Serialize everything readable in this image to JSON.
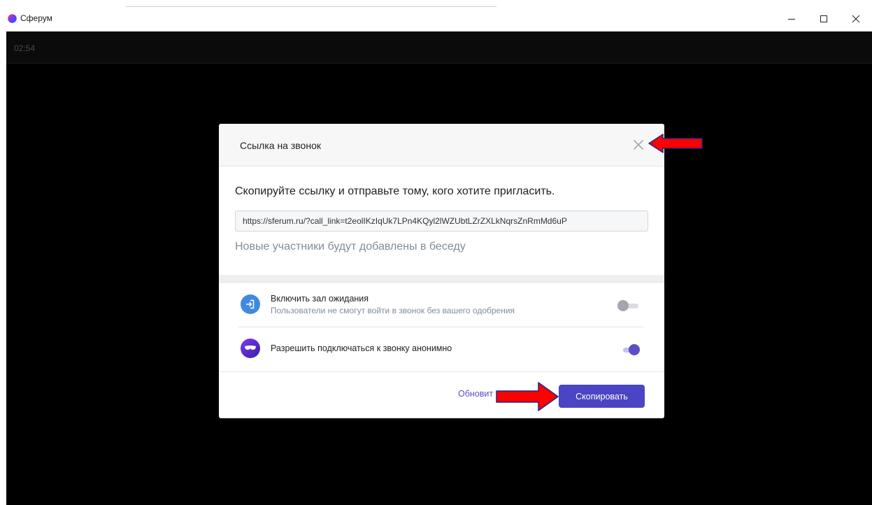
{
  "window": {
    "title": "Сферум",
    "icon": "sferum-logo-icon",
    "controls": {
      "minimize_icon": "minimize-icon",
      "maximize_icon": "maximize-icon",
      "close_icon": "close-icon"
    }
  },
  "call": {
    "timer": "02:54",
    "background": "#000000"
  },
  "modal": {
    "title": "Ссылка на звонок",
    "close_icon": "close-x-icon",
    "instruction": "Скопируйте ссылку и отправьте тому, кого хотите пригласить.",
    "call_link": "https://sferum.ru/?call_link=t2eolIKzIqUk7LPn4KQyl2lWZUbtLZrZXLkNqrsZnRmMd6uP",
    "note": "Новые участники будут добавлены в беседу",
    "settings": [
      {
        "label": "Включить зал ожидания",
        "description": "Пользователи не смогут войти в звонок без вашего одобрения",
        "icon": "waiting-room-icon",
        "enabled": false
      },
      {
        "label": "Разрешить подключаться к звонку анонимно",
        "icon": "anonymous-mask-icon",
        "enabled": true
      }
    ],
    "footer": {
      "refresh_label": "Обновит",
      "copy_label": "Скопировать"
    }
  },
  "colors": {
    "accent": "#4b44c4",
    "link": "#5a4fc4",
    "annotation_arrow": "#ff0000"
  },
  "annotations": [
    {
      "icon": "red-arrow-icon",
      "points_to": "close-x-icon"
    },
    {
      "icon": "red-arrow-icon",
      "points_to": "copy-button"
    }
  ]
}
